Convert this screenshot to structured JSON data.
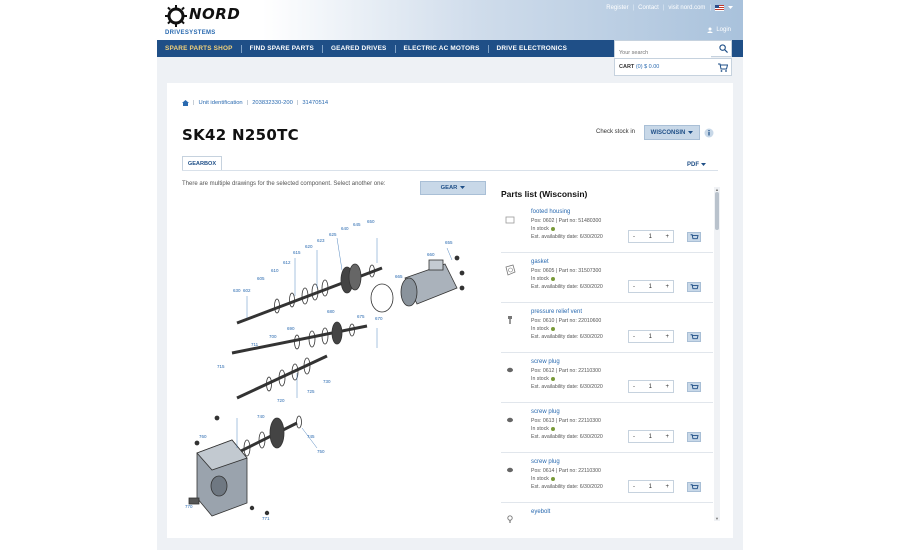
{
  "header": {
    "logo_text": "NORD",
    "logo_sub": "DRIVESYSTEMS",
    "top_links": [
      "Register",
      "Contact",
      "visit nord.com"
    ],
    "login": "Login"
  },
  "nav": {
    "items": [
      "SPARE PARTS SHOP",
      "FIND SPARE PARTS",
      "GEARED DRIVES",
      "ELECTRIC AC MOTORS",
      "DRIVE ELECTRONICS"
    ]
  },
  "search": {
    "placeholder": "Your search"
  },
  "cart": {
    "label": "CART",
    "value": "(0) $ 0.00"
  },
  "breadcrumb": [
    "Unit identification",
    "203832330-200",
    "31470514"
  ],
  "page": {
    "title": "SK42 N250TC",
    "check_stock_label": "Check stock in",
    "stock_location": "WISCONSIN",
    "tab_label": "GEARBOX",
    "pdf_label": "PDF",
    "multi_drawing_text": "There are multiple drawings for the selected component. Select another one:",
    "gear_dropdown": "GEAR"
  },
  "parts": {
    "header": "Parts list (Wisconsin)",
    "items": [
      {
        "name": "footed housing",
        "pos": "Pos: 0602 | Part no: 51480300",
        "stock": "In stock",
        "avail": "Est. availability date: 6/30/2020",
        "qty": "1"
      },
      {
        "name": "gasket",
        "pos": "Pos: 0605 | Part no: 31507300",
        "stock": "In stock",
        "avail": "Est. availability date: 6/30/2020",
        "qty": "1"
      },
      {
        "name": "pressure relief vent",
        "pos": "Pos: 0610 | Part no: 22010600",
        "stock": "In stock",
        "avail": "Est. availability date: 6/30/2020",
        "qty": "1"
      },
      {
        "name": "screw plug",
        "pos": "Pos: 0612 | Part no: 22110300",
        "stock": "In stock",
        "avail": "Est. availability date: 6/30/2020",
        "qty": "1"
      },
      {
        "name": "screw plug",
        "pos": "Pos: 0613 | Part no: 22110300",
        "stock": "In stock",
        "avail": "Est. availability date: 6/30/2020",
        "qty": "1"
      },
      {
        "name": "screw plug",
        "pos": "Pos: 0614 | Part no: 22110300",
        "stock": "In stock",
        "avail": "Est. availability date: 6/30/2020",
        "qty": "1"
      },
      {
        "name": "eyebolt",
        "pos": "",
        "stock": "",
        "avail": "",
        "qty": ""
      }
    ],
    "qty_minus": "-",
    "qty_plus": "+"
  },
  "drawing_labels": [
    "630",
    "602",
    "605",
    "610",
    "612",
    "615",
    "620",
    "623",
    "625",
    "640",
    "645",
    "650",
    "655",
    "660",
    "665",
    "670",
    "675",
    "680",
    "690",
    "700",
    "711",
    "715",
    "720",
    "725",
    "730",
    "740",
    "745",
    "750",
    "760",
    "770",
    "771"
  ],
  "colors": {
    "nav": "#1f4f87",
    "accent": "#2a6ab0",
    "button": "#c8d8e8",
    "stock_dot": "#7a9a3a"
  }
}
